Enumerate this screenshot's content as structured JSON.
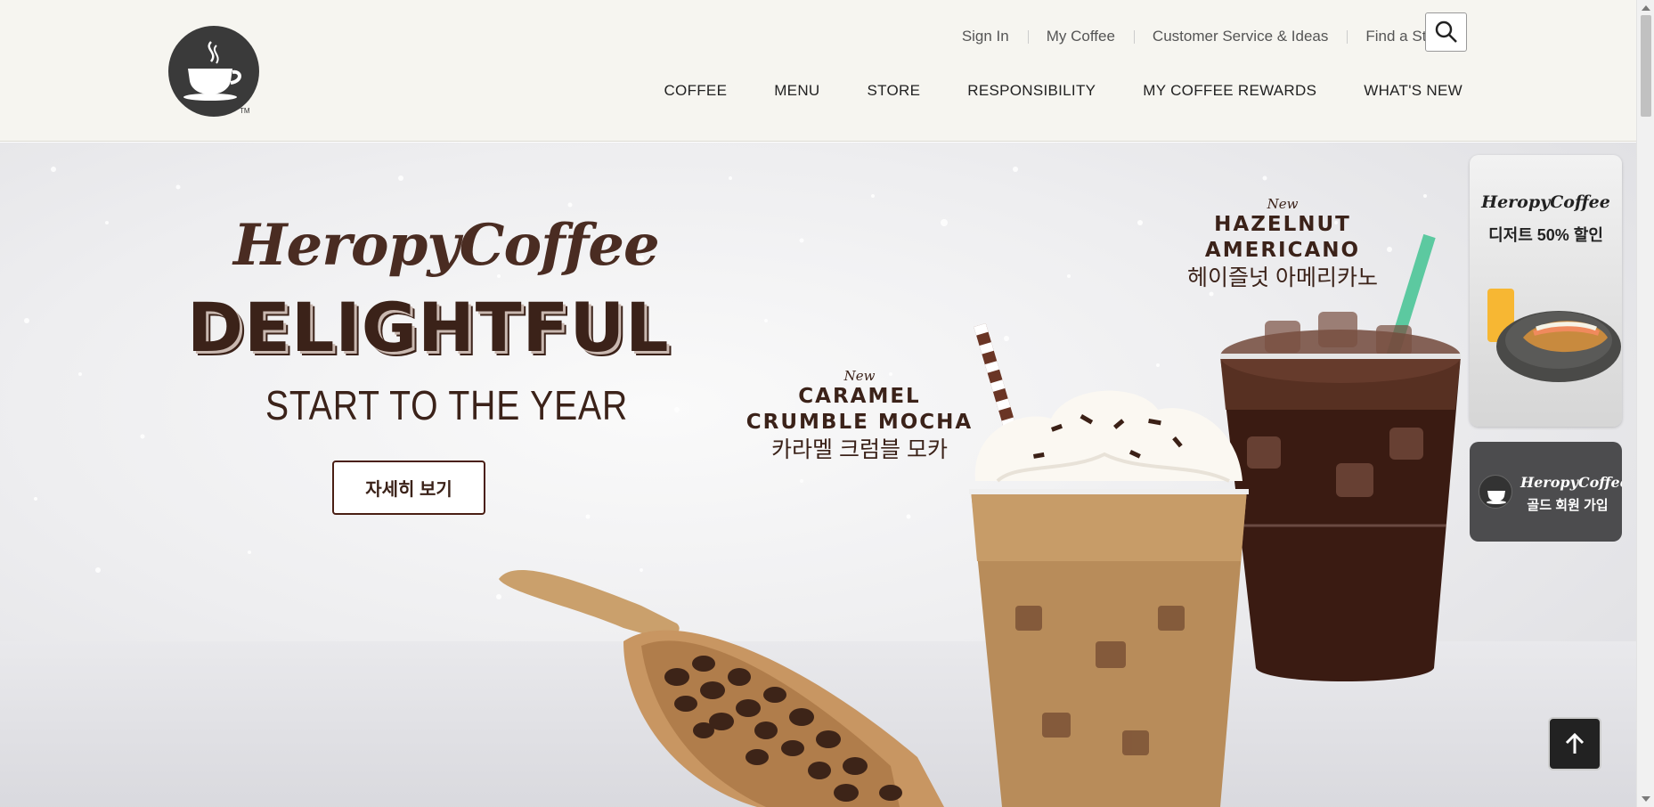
{
  "header": {
    "logo_icon": "coffee-cup-logo",
    "utility_links": [
      "Sign In",
      "My Coffee",
      "Customer Service & Ideas",
      "Find a Store"
    ],
    "search_icon": "search-icon",
    "nav": [
      "COFFEE",
      "MENU",
      "STORE",
      "RESPONSIBILITY",
      "MY COFFEE REWARDS",
      "WHAT'S NEW"
    ]
  },
  "hero": {
    "brand": "HeropyCoffee",
    "headline": "DELIGHTFUL",
    "subhead": "START TO THE YEAR",
    "cta_label": "자세히 보기",
    "products": [
      {
        "badge": "New",
        "name_line1": "HAZELNUT",
        "name_line2": "AMERICANO",
        "name_ko": "헤이즐넛 아메리카노"
      },
      {
        "badge": "New",
        "name_line1": "CARAMEL",
        "name_line2": "CRUMBLE MOCHA",
        "name_ko": "카라멜 크럼블 모카"
      }
    ]
  },
  "side_banners": [
    {
      "brand": "HeropyCoffee",
      "text": "디저트 50% 할인"
    },
    {
      "brand": "HeropyCoffee",
      "text": "골드 회원 가입"
    }
  ],
  "colors": {
    "header_bg": "#f6f5f0",
    "brand_brown": "#3b2219",
    "button_border": "#4a1f14"
  },
  "scroll_top_icon": "arrow-up-icon"
}
